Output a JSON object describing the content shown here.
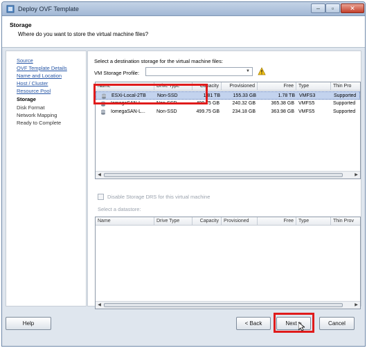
{
  "window": {
    "title": "Deploy OVF Template",
    "controls": {
      "minimize": "–",
      "maximize": "▫",
      "close": "✕"
    }
  },
  "header": {
    "title": "Storage",
    "subtitle": "Where do you want to store the virtual machine files?"
  },
  "nav": {
    "items": [
      {
        "label": "Source",
        "state": "link"
      },
      {
        "label": "OVF Template Details",
        "state": "link"
      },
      {
        "label": "Name and Location",
        "state": "link"
      },
      {
        "label": "Host / Cluster",
        "state": "link"
      },
      {
        "label": "Resource Pool",
        "state": "link"
      },
      {
        "label": "Storage",
        "state": "current"
      },
      {
        "label": "Disk Format",
        "state": "pending"
      },
      {
        "label": "Network Mapping",
        "state": "pending"
      },
      {
        "label": "Ready to Complete",
        "state": "pending"
      }
    ]
  },
  "content": {
    "select_label": "Select a destination storage for the virtual machine files:",
    "profile_label": "VM Storage Profile:",
    "profile_value": "",
    "warning_icon": "warning-icon",
    "storage_table": {
      "columns": [
        "Name",
        "Drive Type",
        "Capacity",
        "Provisioned",
        "Free",
        "Type",
        "Thin Pro"
      ],
      "rows": [
        {
          "name": "ESXi-Local-2TB",
          "drive": "Non-SSD",
          "capacity": "1.81 TB",
          "provisioned": "155.33 GB",
          "free": "1.78 TB",
          "type": "VMFS3",
          "thin": "Supported",
          "selected": true
        },
        {
          "name": "IomegaSAN-L...",
          "drive": "Non-SSD",
          "capacity": "499.75 GB",
          "provisioned": "240.32 GB",
          "free": "365.38 GB",
          "type": "VMFS5",
          "thin": "Supported",
          "selected": false
        },
        {
          "name": "IomegaSAN-L...",
          "drive": "Non-SSD",
          "capacity": "499.75 GB",
          "provisioned": "234.18 GB",
          "free": "363.98 GB",
          "type": "VMFS5",
          "thin": "Supported",
          "selected": false
        }
      ]
    },
    "disable_sdrs_label": "Disable Storage DRS for this virtual machine",
    "datastore_label": "Select a datastore:",
    "datastore_table": {
      "columns": [
        "Name",
        "Drive Type",
        "Capacity",
        "Provisioned",
        "Free",
        "Type",
        "Thin Prov"
      ]
    }
  },
  "footer": {
    "help": "Help",
    "back": "< Back",
    "next": "Next >",
    "cancel": "Cancel"
  },
  "colors": {
    "highlight": "#e01b1b",
    "link": "#2454a5",
    "selection": "#c3d3ee"
  }
}
